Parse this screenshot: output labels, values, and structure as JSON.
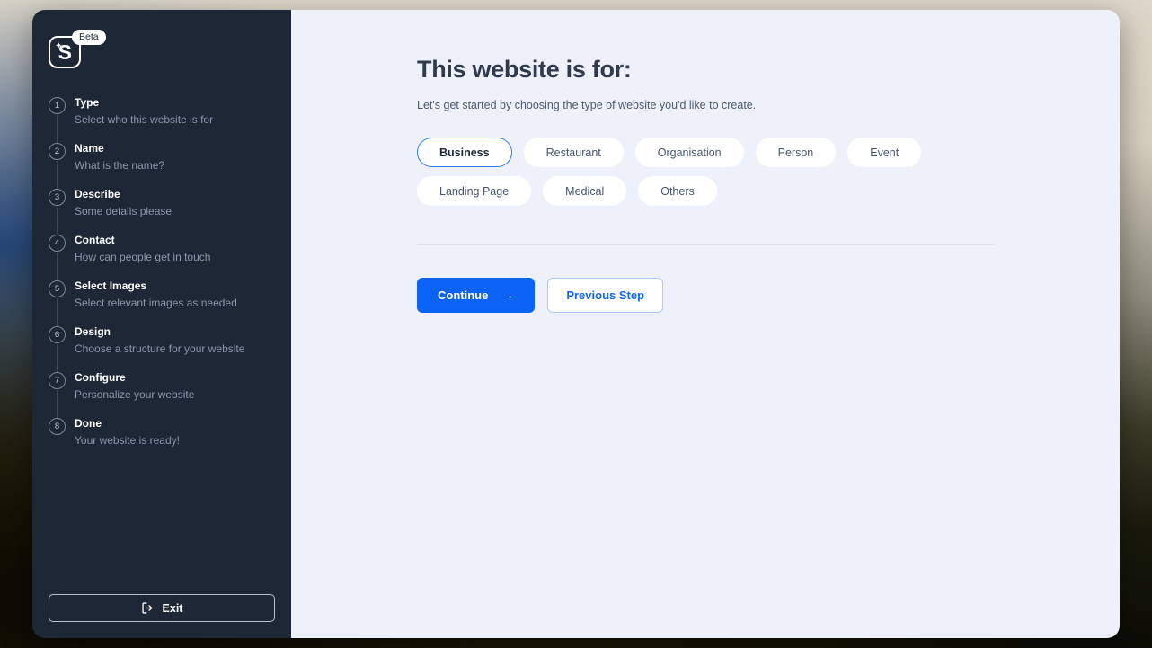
{
  "brand": {
    "logo_letter": "S",
    "sparkle_icon": "sparkle-icon",
    "badge": "Beta"
  },
  "sidebar": {
    "steps": [
      {
        "number": "1",
        "title": "Type",
        "subtitle": "Select who this website is for"
      },
      {
        "number": "2",
        "title": "Name",
        "subtitle": "What is the name?"
      },
      {
        "number": "3",
        "title": "Describe",
        "subtitle": "Some details please"
      },
      {
        "number": "4",
        "title": "Contact",
        "subtitle": "How can people get in touch"
      },
      {
        "number": "5",
        "title": "Select Images",
        "subtitle": "Select relevant images as needed"
      },
      {
        "number": "6",
        "title": "Design",
        "subtitle": "Choose a structure for your website"
      },
      {
        "number": "7",
        "title": "Configure",
        "subtitle": "Personalize your website"
      },
      {
        "number": "8",
        "title": "Done",
        "subtitle": "Your website is ready!"
      }
    ],
    "exit_label": "Exit",
    "exit_icon": "logout-icon"
  },
  "main": {
    "title": "This website is for:",
    "subtitle": "Let's get started by choosing the type of website you'd like to create.",
    "chips": [
      {
        "label": "Business",
        "selected": true
      },
      {
        "label": "Restaurant",
        "selected": false
      },
      {
        "label": "Organisation",
        "selected": false
      },
      {
        "label": "Person",
        "selected": false
      },
      {
        "label": "Event",
        "selected": false
      },
      {
        "label": "Landing Page",
        "selected": false
      },
      {
        "label": "Medical",
        "selected": false
      },
      {
        "label": "Others",
        "selected": false
      }
    ],
    "continue_label": "Continue",
    "continue_icon": "arrow-right-icon",
    "previous_label": "Previous Step"
  },
  "colors": {
    "sidebar_bg": "#1d2735",
    "content_bg": "#eef1fa",
    "accent_blue": "#0b63f6",
    "chip_selected_border": "#2b7cf3",
    "step_muted_text": "#8c99ab"
  }
}
